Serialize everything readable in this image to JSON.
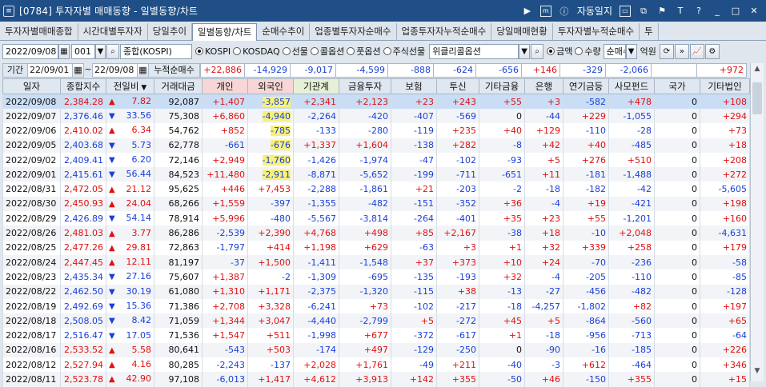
{
  "window": {
    "screen_no": "[0784]",
    "title": "투자자별 매매동향 - 일별동향/차트",
    "autolog_label": "자동일지"
  },
  "tabs": [
    "투자자별매매종합",
    "시간대별투자자",
    "당일추이",
    "일별동향/차트",
    "순매수추이",
    "업종별투자자순매수",
    "업종투자자누적순매수",
    "당일매매현황",
    "투자자별누적순매수",
    "투"
  ],
  "active_tab": 3,
  "toolbar": {
    "date": "2022/09/08",
    "code": "001",
    "market_name": "종합(KOSPI)",
    "radios": [
      {
        "label": "KOSPI",
        "on": true
      },
      {
        "label": "KOSDAQ",
        "on": false
      },
      {
        "label": "선물",
        "on": false
      },
      {
        "label": "콜옵션",
        "on": false
      },
      {
        "label": "풋옵션",
        "on": false
      },
      {
        "label": "주식선물",
        "on": false
      }
    ],
    "option_select": "위클리콜옵션",
    "unit_radios": [
      {
        "label": "금액",
        "on": true
      },
      {
        "label": "수량",
        "on": false
      }
    ],
    "sort_select": "순매수",
    "unit_label": "억원"
  },
  "summary": {
    "period_label": "기간",
    "from": "22/09/01",
    "tilde": "~",
    "to": "22/09/08",
    "cum_label": "누적순매수",
    "values": [
      "+22,886",
      "-14,929",
      "-9,017",
      "-4,599",
      "-888",
      "-624",
      "-656",
      "+146",
      "-329",
      "-2,066",
      "",
      "+972"
    ]
  },
  "columns": [
    "일자",
    "종합지수",
    "전일비",
    "거래대금",
    "개인",
    "외국인",
    "기관계",
    "금융투자",
    "보험",
    "투신",
    "기타금융",
    "은행",
    "연기금등",
    "사모펀드",
    "국가",
    "기타법인"
  ],
  "rows": [
    {
      "date": "2022/09/08",
      "idx": "2,384.28",
      "dir": "up",
      "chg": "7.82",
      "amt": "92,087",
      "v": [
        "+1,407",
        "-3,857",
        "+2,341",
        "+2,123",
        "+23",
        "+243",
        "+55",
        "+3",
        "-582",
        "+478",
        "0",
        "+108"
      ],
      "hl": true
    },
    {
      "date": "2022/09/07",
      "idx": "2,376.46",
      "dir": "dn",
      "chg": "33.56",
      "amt": "75,308",
      "v": [
        "+6,860",
        "-4,940",
        "-2,264",
        "-420",
        "-407",
        "-569",
        "0",
        "-44",
        "+229",
        "-1,055",
        "0",
        "+294"
      ],
      "hl": true
    },
    {
      "date": "2022/09/06",
      "idx": "2,410.02",
      "dir": "up",
      "chg": "6.34",
      "amt": "54,762",
      "v": [
        "+852",
        "-785",
        "-133",
        "-280",
        "-119",
        "+235",
        "+40",
        "+129",
        "-110",
        "-28",
        "0",
        "+73"
      ],
      "hl": true
    },
    {
      "date": "2022/09/05",
      "idx": "2,403.68",
      "dir": "dn",
      "chg": "5.73",
      "amt": "62,778",
      "v": [
        "-661",
        "-676",
        "+1,337",
        "+1,604",
        "-138",
        "+282",
        "-8",
        "+42",
        "+40",
        "-485",
        "0",
        "+18"
      ],
      "hl": true
    },
    {
      "date": "2022/09/02",
      "idx": "2,409.41",
      "dir": "dn",
      "chg": "6.20",
      "amt": "72,146",
      "v": [
        "+2,949",
        "-1,760",
        "-1,426",
        "-1,974",
        "-47",
        "-102",
        "-93",
        "+5",
        "+276",
        "+510",
        "0",
        "+208"
      ],
      "hl": true
    },
    {
      "date": "2022/09/01",
      "idx": "2,415.61",
      "dir": "dn",
      "chg": "56.44",
      "amt": "84,523",
      "v": [
        "+11,480",
        "-2,911",
        "-8,871",
        "-5,652",
        "-199",
        "-711",
        "-651",
        "+11",
        "-181",
        "-1,488",
        "0",
        "+272"
      ],
      "hl": true
    },
    {
      "date": "2022/08/31",
      "idx": "2,472.05",
      "dir": "up",
      "chg": "21.12",
      "amt": "95,625",
      "v": [
        "+446",
        "+7,453",
        "-2,288",
        "-1,861",
        "+21",
        "-203",
        "-2",
        "-18",
        "-182",
        "-42",
        "0",
        "-5,605"
      ],
      "hl": false
    },
    {
      "date": "2022/08/30",
      "idx": "2,450.93",
      "dir": "up",
      "chg": "24.04",
      "amt": "68,266",
      "v": [
        "+1,559",
        "-397",
        "-1,355",
        "-482",
        "-151",
        "-352",
        "+36",
        "-4",
        "+19",
        "-421",
        "0",
        "+198"
      ],
      "hl": false
    },
    {
      "date": "2022/08/29",
      "idx": "2,426.89",
      "dir": "dn",
      "chg": "54.14",
      "amt": "78,914",
      "v": [
        "+5,996",
        "-480",
        "-5,567",
        "-3,814",
        "-264",
        "-401",
        "+35",
        "+23",
        "+55",
        "-1,201",
        "0",
        "+160"
      ],
      "hl": false
    },
    {
      "date": "2022/08/26",
      "idx": "2,481.03",
      "dir": "up",
      "chg": "3.77",
      "amt": "86,286",
      "v": [
        "-2,539",
        "+2,390",
        "+4,768",
        "+498",
        "+85",
        "+2,167",
        "-38",
        "+18",
        "-10",
        "+2,048",
        "0",
        "-4,631"
      ],
      "hl": false
    },
    {
      "date": "2022/08/25",
      "idx": "2,477.26",
      "dir": "up",
      "chg": "29.81",
      "amt": "72,863",
      "v": [
        "-1,797",
        "+414",
        "+1,198",
        "+629",
        "-63",
        "+3",
        "+1",
        "+32",
        "+339",
        "+258",
        "0",
        "+179"
      ],
      "hl": false
    },
    {
      "date": "2022/08/24",
      "idx": "2,447.45",
      "dir": "up",
      "chg": "12.11",
      "amt": "81,197",
      "v": [
        "-37",
        "+1,500",
        "-1,411",
        "-1,548",
        "+37",
        "+373",
        "+10",
        "+24",
        "-70",
        "-236",
        "0",
        "-58"
      ],
      "hl": false
    },
    {
      "date": "2022/08/23",
      "idx": "2,435.34",
      "dir": "dn",
      "chg": "27.16",
      "amt": "75,607",
      "v": [
        "+1,387",
        "-2",
        "-1,309",
        "-695",
        "-135",
        "-193",
        "+32",
        "-4",
        "-205",
        "-110",
        "0",
        "-85"
      ],
      "hl": false
    },
    {
      "date": "2022/08/22",
      "idx": "2,462.50",
      "dir": "dn",
      "chg": "30.19",
      "amt": "61,080",
      "v": [
        "+1,310",
        "+1,171",
        "-2,375",
        "-1,320",
        "-115",
        "+38",
        "-13",
        "-27",
        "-456",
        "-482",
        "0",
        "-128"
      ],
      "hl": false
    },
    {
      "date": "2022/08/19",
      "idx": "2,492.69",
      "dir": "dn",
      "chg": "15.36",
      "amt": "71,386",
      "v": [
        "+2,708",
        "+3,328",
        "-6,241",
        "+73",
        "-102",
        "-217",
        "-18",
        "-4,257",
        "-1,802",
        "+82",
        "0",
        "+197"
      ],
      "hl": false
    },
    {
      "date": "2022/08/18",
      "idx": "2,508.05",
      "dir": "dn",
      "chg": "8.42",
      "amt": "71,059",
      "v": [
        "+1,344",
        "+3,047",
        "-4,440",
        "-2,799",
        "+5",
        "-272",
        "+45",
        "+5",
        "-864",
        "-560",
        "0",
        "+65"
      ],
      "hl": false
    },
    {
      "date": "2022/08/17",
      "idx": "2,516.47",
      "dir": "dn",
      "chg": "17.05",
      "amt": "71,536",
      "v": [
        "+1,547",
        "+511",
        "-1,998",
        "+677",
        "-372",
        "-617",
        "+1",
        "-18",
        "-956",
        "-713",
        "0",
        "-64"
      ],
      "hl": false
    },
    {
      "date": "2022/08/16",
      "idx": "2,533.52",
      "dir": "up",
      "chg": "5.58",
      "amt": "80,641",
      "v": [
        "-543",
        "+503",
        "-174",
        "+497",
        "-129",
        "-250",
        "0",
        "-90",
        "-16",
        "-185",
        "0",
        "+226"
      ],
      "hl": false
    },
    {
      "date": "2022/08/12",
      "idx": "2,527.94",
      "dir": "up",
      "chg": "4.16",
      "amt": "80,285",
      "v": [
        "-2,243",
        "-137",
        "+2,028",
        "+1,761",
        "-49",
        "+211",
        "-40",
        "-3",
        "+612",
        "-464",
        "0",
        "+346"
      ],
      "hl": false
    },
    {
      "date": "2022/08/11",
      "idx": "2,523.78",
      "dir": "up",
      "chg": "42.90",
      "amt": "97,108",
      "v": [
        "-6,013",
        "+1,417",
        "+4,612",
        "+3,913",
        "+142",
        "+355",
        "-50",
        "+46",
        "-150",
        "+355",
        "0",
        "+15"
      ],
      "hl": false
    }
  ],
  "colors": {
    "title_bar": "#1f4f86",
    "up": "#e01010",
    "down": "#1a3fd8",
    "highlight": "#f7f17a",
    "selected_row": "#c9def5"
  }
}
